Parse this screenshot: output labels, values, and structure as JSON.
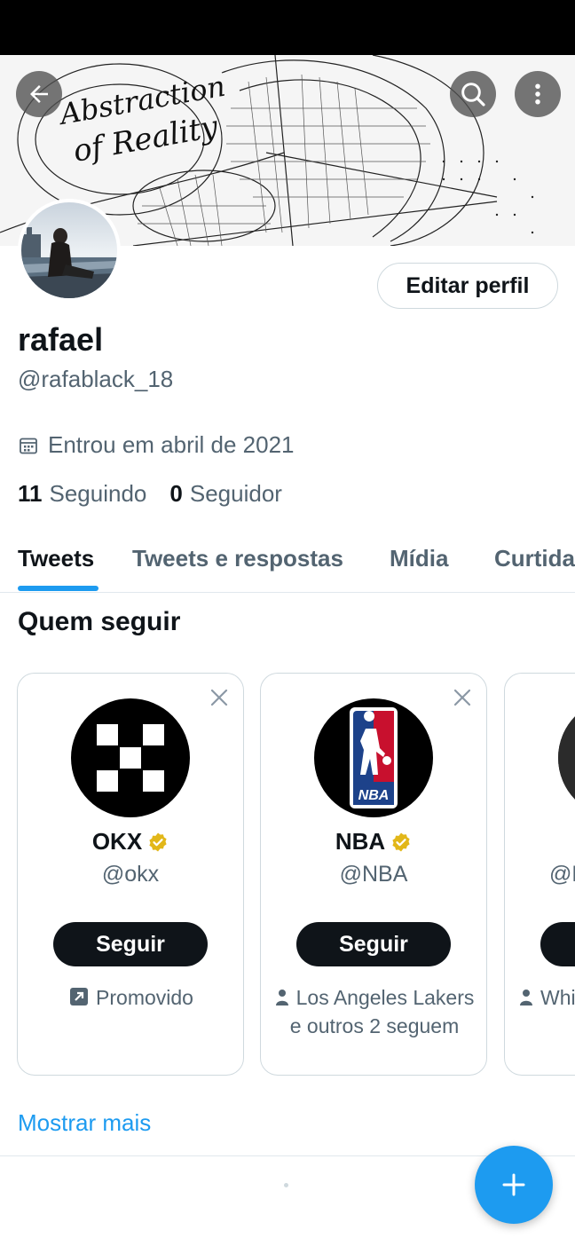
{
  "header": {
    "banner_text_1": "Abstraction",
    "banner_text_2": "of Reality"
  },
  "profile": {
    "name": "rafael",
    "handle": "@rafablack_18",
    "joined": "Entrou em abril de 2021",
    "following_count": "11",
    "following_label": "Seguindo",
    "followers_count": "0",
    "followers_label": "Seguidor",
    "edit_label": "Editar perfil"
  },
  "tabs": [
    {
      "label": "Tweets",
      "active": true
    },
    {
      "label": "Tweets e respostas",
      "active": false
    },
    {
      "label": "Mídia",
      "active": false
    },
    {
      "label": "Curtidas",
      "active": false
    }
  ],
  "who_to_follow": {
    "title": "Quem seguir",
    "cards": [
      {
        "name": "OKX",
        "handle": "@okx",
        "follow_label": "Seguir",
        "meta": "Promovido",
        "meta_icon": "promoted-icon"
      },
      {
        "name": "NBA",
        "handle": "@NBA",
        "follow_label": "Seguir",
        "meta": "Los Angeles Lakers e outros 2 seguem",
        "meta_icon": "person-icon"
      },
      {
        "name": "",
        "handle": "@L",
        "follow_label": "",
        "meta": "Whi segu",
        "meta_icon": "person-icon"
      }
    ],
    "show_more": "Mostrar mais"
  },
  "colors": {
    "accent": "#1d9bf0",
    "verified": "#e2b719",
    "text_primary": "#0f1419",
    "text_secondary": "#536471"
  }
}
